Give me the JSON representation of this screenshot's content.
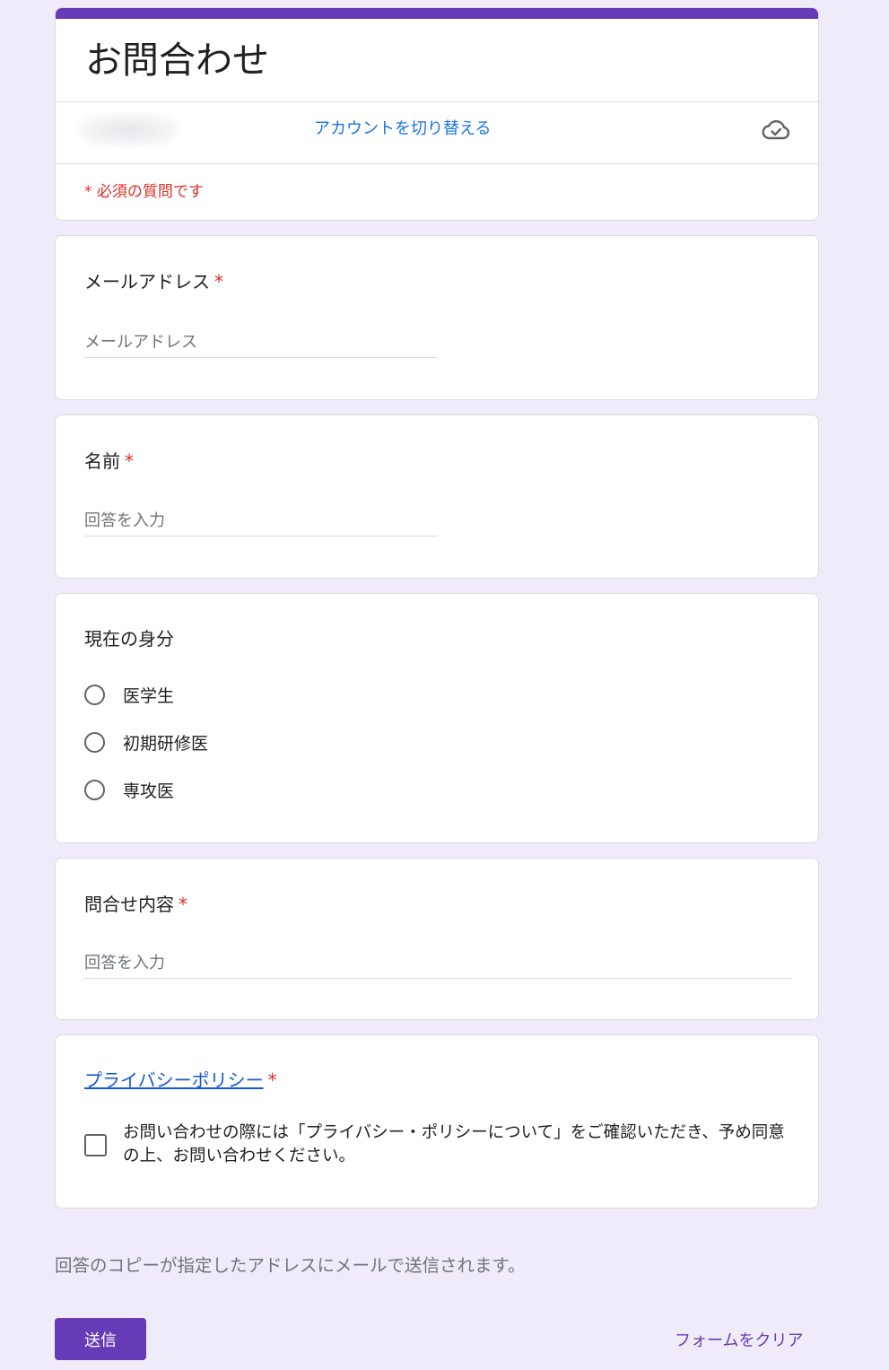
{
  "form": {
    "title": "お問合わせ",
    "switch_account": "アカウントを切り替える",
    "required_note": "* 必須の質問です",
    "icons": {
      "cloud": "cloud-check-icon"
    }
  },
  "questions": {
    "email": {
      "title": "メールアドレス",
      "required_mark": "*",
      "placeholder": "メールアドレス"
    },
    "name": {
      "title": "名前",
      "required_mark": "*",
      "placeholder": "回答を入力"
    },
    "status": {
      "title": "現在の身分",
      "options": [
        "医学生",
        "初期研修医",
        "専攻医"
      ]
    },
    "inquiry": {
      "title": "問合せ内容",
      "required_mark": "*",
      "placeholder": "回答を入力"
    },
    "privacy": {
      "title": "プライバシーポリシー",
      "required_mark": "*",
      "checkbox_label": "お問い合わせの際には「プライバシー・ポリシーについて」をご確認いただき、予め同意の上、お問い合わせください。"
    }
  },
  "footer": {
    "note": "回答のコピーが指定したアドレスにメールで送信されます。",
    "submit_label": "送信",
    "clear_label": "フォームをクリア"
  },
  "colors": {
    "accent": "#673ab7",
    "background": "#efebf8",
    "required": "#d93025",
    "link": "#1a73e8"
  }
}
